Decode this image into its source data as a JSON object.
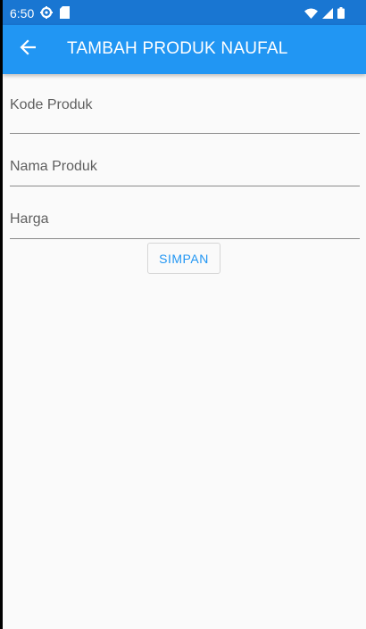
{
  "status_bar": {
    "time": "6:50",
    "icons": [
      "settings-icon",
      "sd-card-icon",
      "wifi-icon",
      "signal-icon",
      "battery-icon"
    ]
  },
  "app_bar": {
    "title": "TAMBAH PRODUK NAUFAL",
    "back_icon": "arrow-back-icon",
    "color": "#2196f3"
  },
  "form": {
    "fields": [
      {
        "name": "kode-produk",
        "placeholder": "Kode Produk",
        "value": ""
      },
      {
        "name": "nama-produk",
        "placeholder": "Nama Produk",
        "value": ""
      },
      {
        "name": "harga",
        "placeholder": "Harga",
        "value": ""
      }
    ],
    "save_label": "SIMPAN"
  },
  "colors": {
    "status_bar": "#1976d2",
    "accent": "#2196f3",
    "background": "#fafafa"
  }
}
